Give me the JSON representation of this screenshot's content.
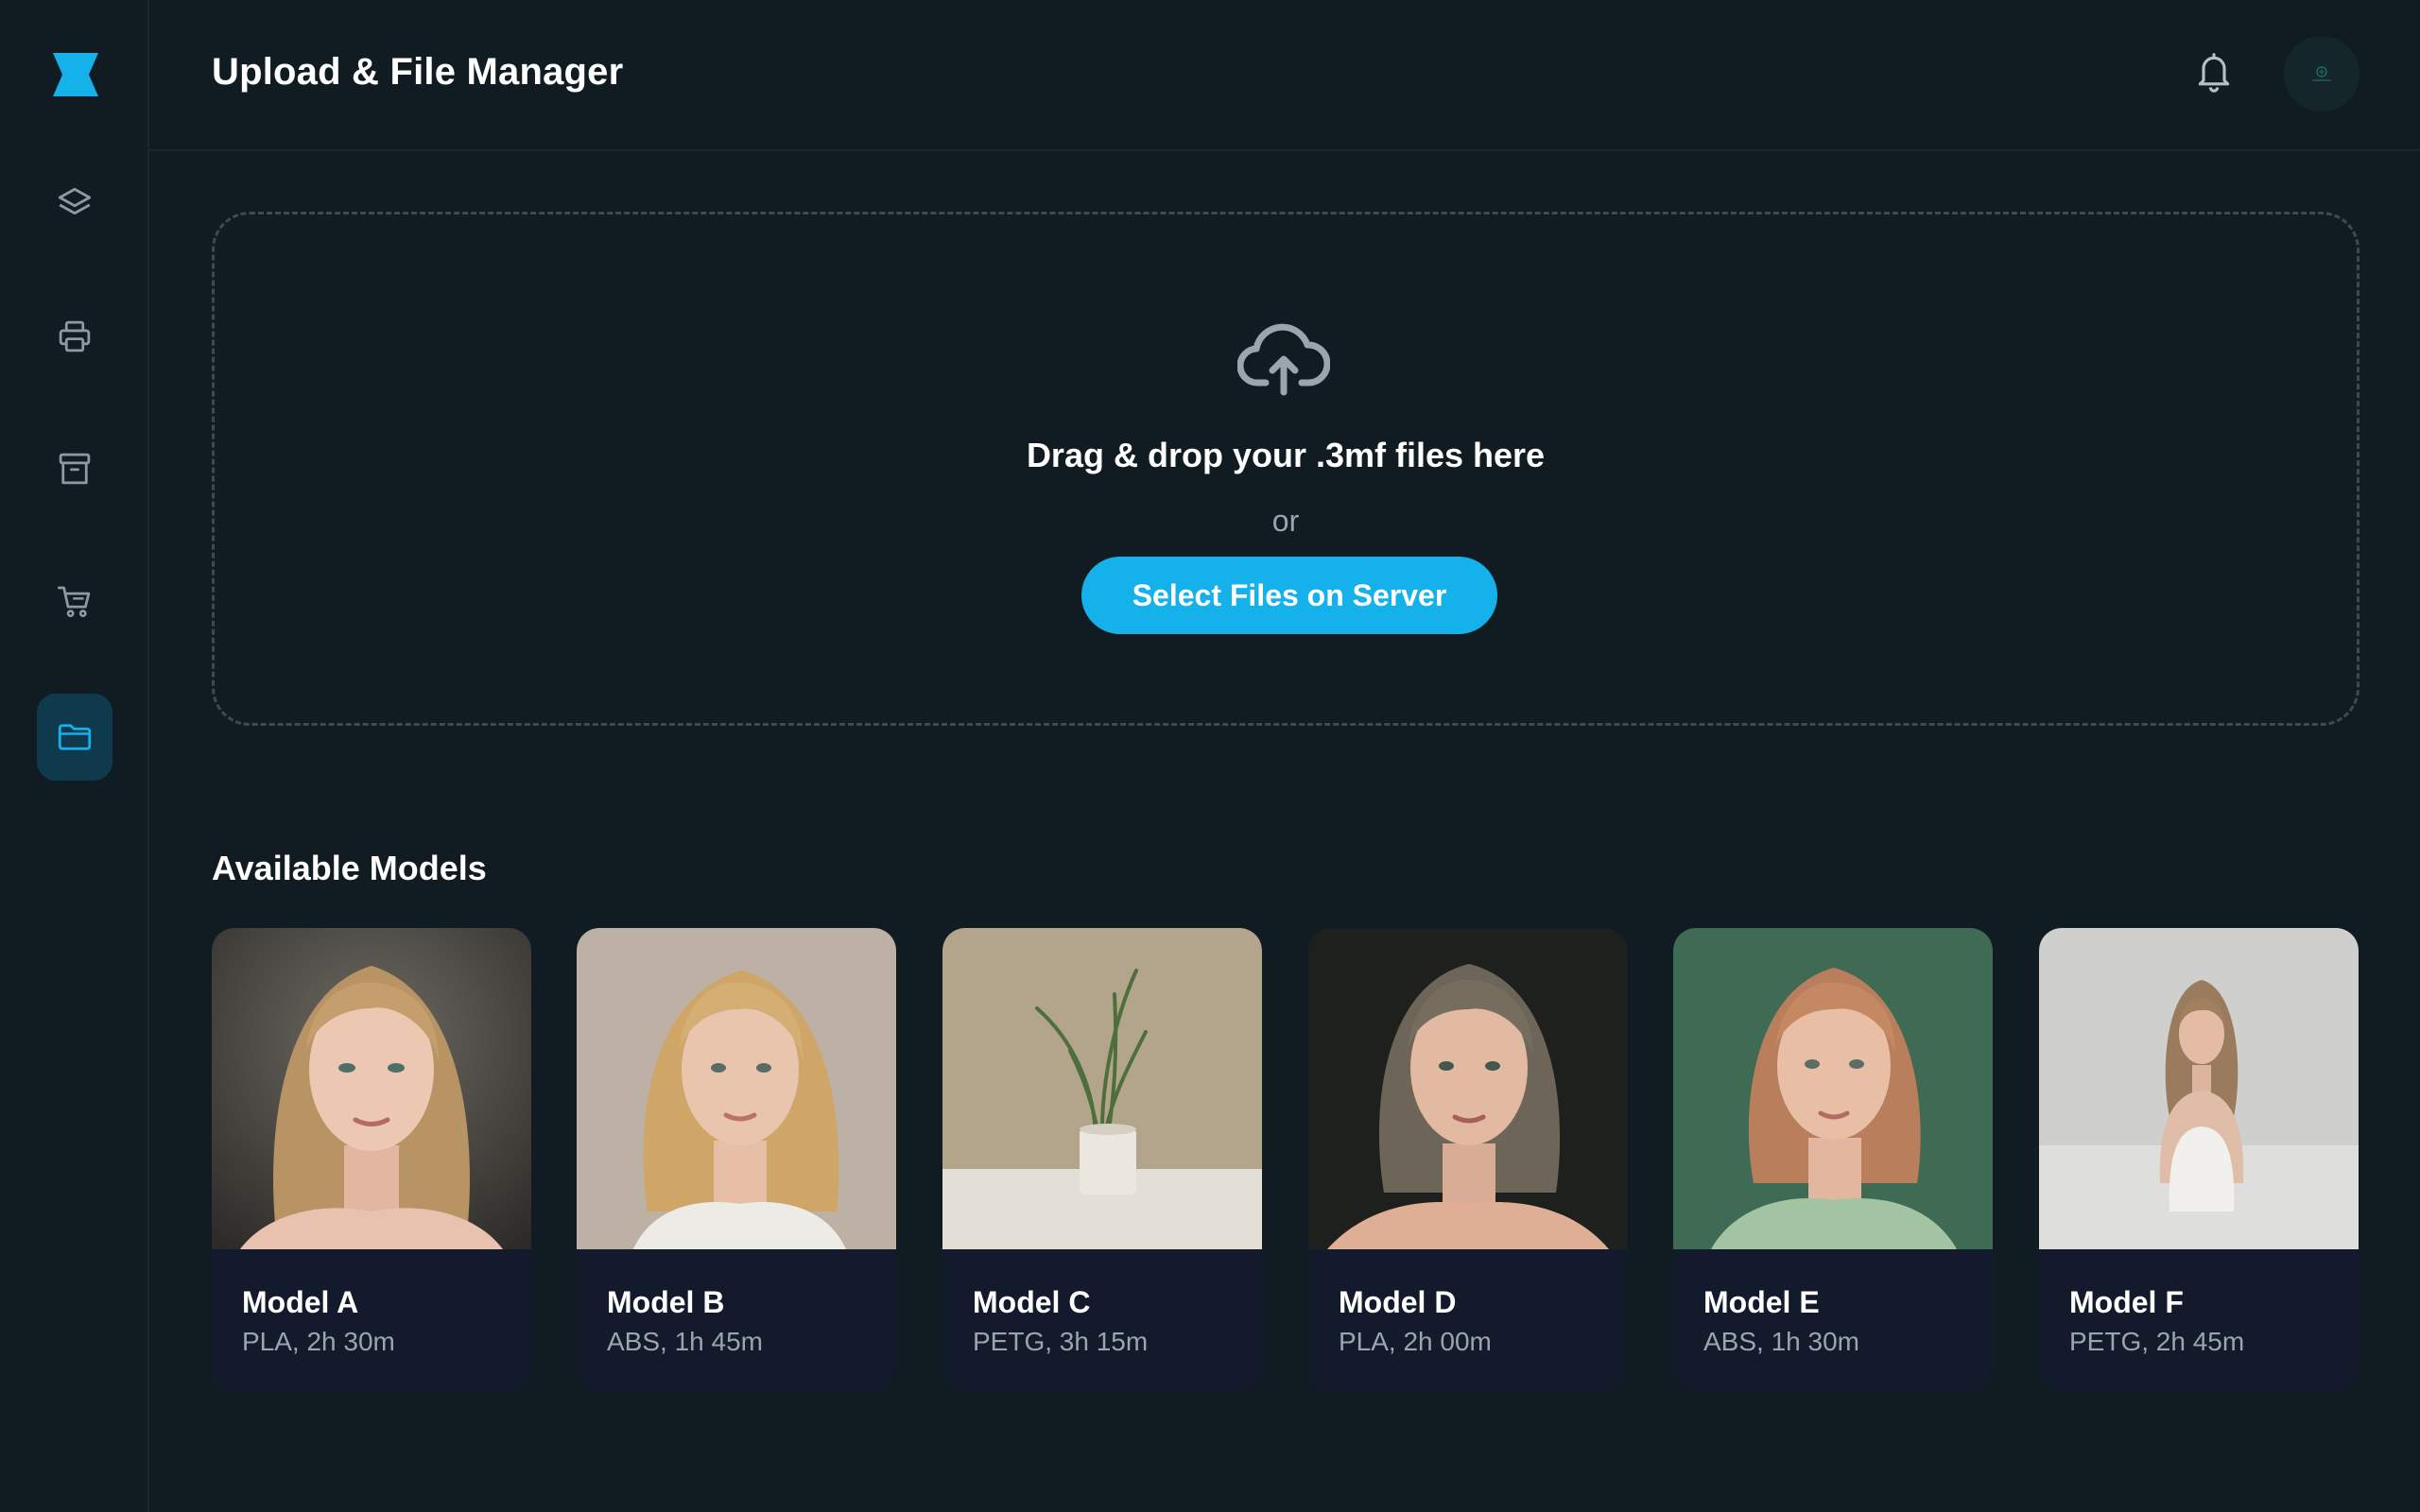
{
  "app": {
    "title": "Upload & File Manager"
  },
  "sidebar": {
    "items": [
      {
        "icon": "layers-icon",
        "name": "sidebar-item-layers"
      },
      {
        "icon": "printer-icon",
        "name": "sidebar-item-printers"
      },
      {
        "icon": "archive-icon",
        "name": "sidebar-item-archive"
      },
      {
        "icon": "cart-icon",
        "name": "sidebar-item-shop"
      },
      {
        "icon": "folder-icon",
        "name": "sidebar-item-files",
        "active": true
      }
    ]
  },
  "header": {
    "title": "Upload & File Manager"
  },
  "dropzone": {
    "title": "Drag & drop your .3mf files here",
    "or": "or",
    "button": "Select Files on Server"
  },
  "models": {
    "title": "Available Models",
    "items": [
      {
        "name": "Model A",
        "meta": "PLA, 2h 30m"
      },
      {
        "name": "Model B",
        "meta": "ABS, 1h 45m"
      },
      {
        "name": "Model C",
        "meta": "PETG, 3h 15m"
      },
      {
        "name": "Model D",
        "meta": "PLA, 2h 00m"
      },
      {
        "name": "Model E",
        "meta": "ABS, 1h 30m"
      },
      {
        "name": "Model F",
        "meta": "PETG, 2h 45m"
      }
    ]
  },
  "colors": {
    "background": "#111c22",
    "accent": "#14b1ea",
    "active_nav": "#0f3a4d",
    "card": "#131a2c",
    "muted_text": "#9aa5ad"
  }
}
